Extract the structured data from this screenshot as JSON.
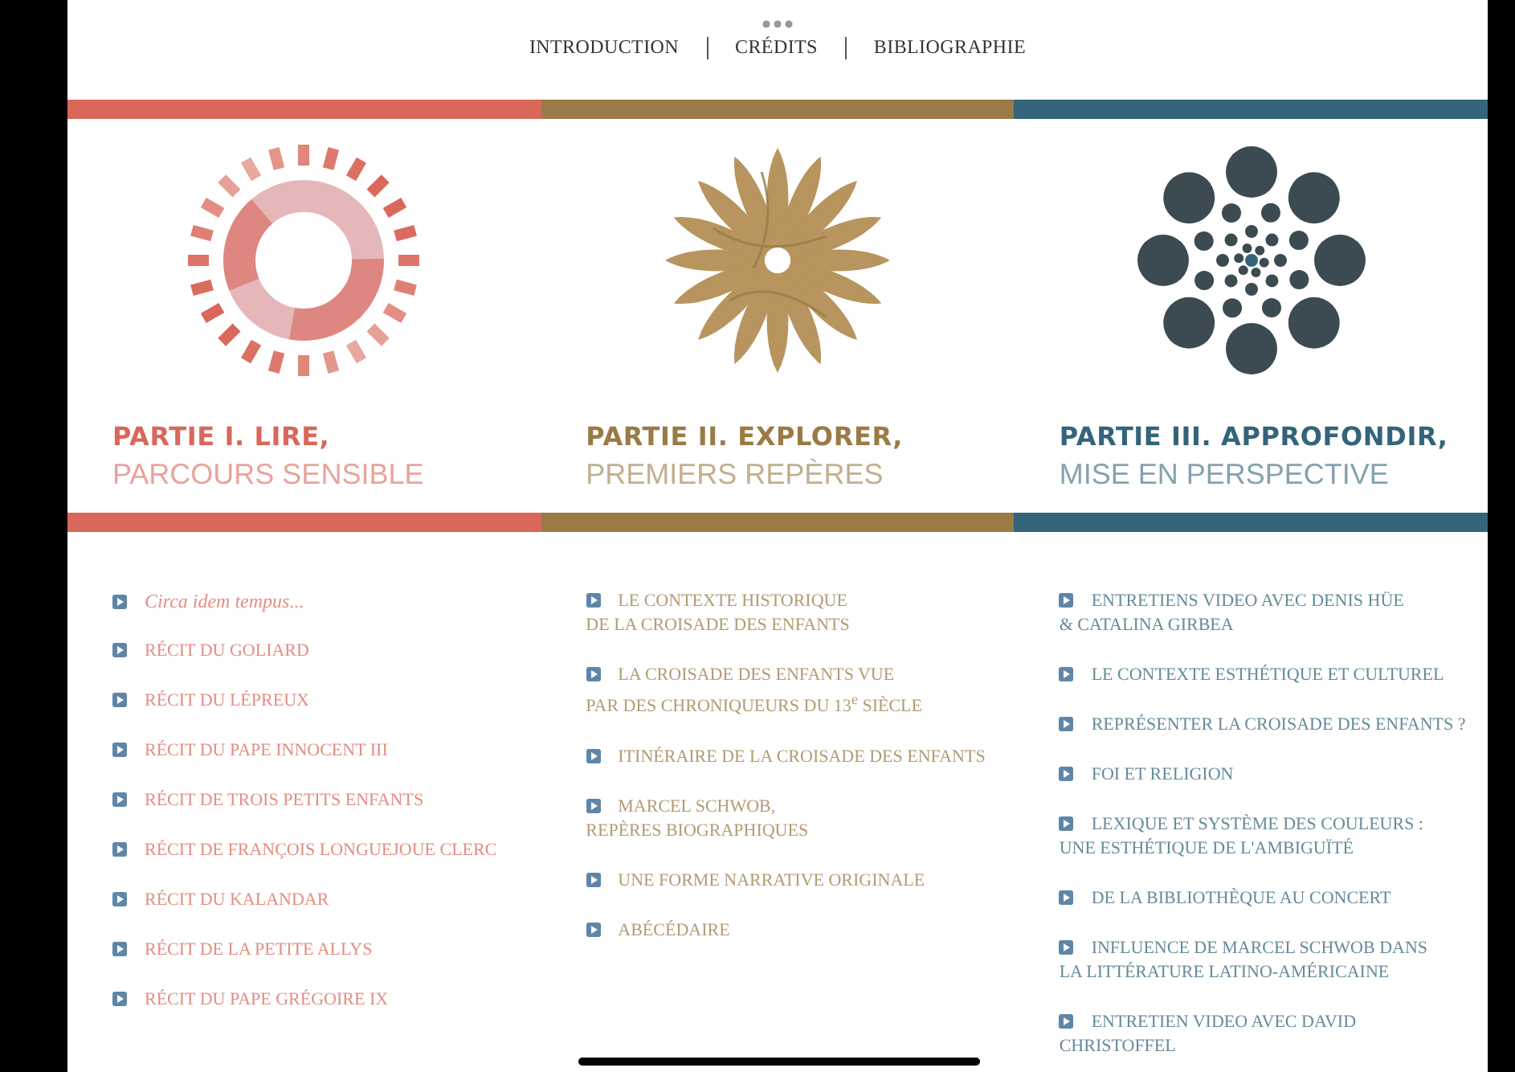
{
  "top_menu": {
    "items": [
      {
        "label": "INTRODUCTION"
      },
      {
        "label": "CRÉDITS"
      },
      {
        "label": "BIBLIOGRAPHIE"
      }
    ]
  },
  "parts": [
    {
      "color": "#d9685a",
      "kind": "ring",
      "title": "PARTIE I. LIRE,",
      "subtitle": "PARCOURS SENSIBLE",
      "links": [
        {
          "text": "Circa idem tempus...",
          "italic": true
        },
        {
          "text": "RÉCIT DU GOLIARD",
          "italic": false
        },
        {
          "text": "RÉCIT DU LÉPREUX",
          "italic": false
        },
        {
          "text": "RÉCIT DU PAPE INNOCENT III",
          "italic": false
        },
        {
          "text": "RÉCIT DE TROIS PETITS ENFANTS",
          "italic": false
        },
        {
          "text": "RÉCIT DE FRANÇOIS LONGUEJOUE CLERC",
          "italic": false
        },
        {
          "text": "RÉCIT DU KALANDAR",
          "italic": false
        },
        {
          "text": "RÉCIT DE LA PETITE ALLYS",
          "italic": false
        },
        {
          "text": "RÉCIT DU PAPE GRÉGOIRE IX",
          "italic": false
        }
      ]
    },
    {
      "color": "#9a7a45",
      "kind": "flower",
      "title": "PARTIE II. EXPLORER,",
      "subtitle": "PREMIERS REPÈRES",
      "links": [
        {
          "text": "LE CONTEXTE HISTORIQUE\nDE LA CROISADE DES ENFANTS",
          "italic": false
        },
        {
          "text": "LA CROISADE DES ENFANTS VUE\nPAR DES CHRONIQUEURS DU 13$^{e}$ SIÈCLE",
          "italic": false
        },
        {
          "text": "ITINÉRAIRE DE LA CROISADE DES ENFANTS",
          "italic": false
        },
        {
          "text": "MARCEL SCHWOB,\nREPÈRES BIOGRAPHIQUES",
          "italic": false
        },
        {
          "text": "UNE FORME NARRATIVE ORIGINALE",
          "italic": false
        },
        {
          "text": "ABÉCÉDAIRE",
          "italic": false
        }
      ]
    },
    {
      "color": "#336479",
      "kind": "circles",
      "title": "PARTIE III. APPROFONDIR,",
      "subtitle": "MISE EN PERSPECTIVE",
      "links": [
        {
          "text": "ENTRETIENS VIDEO AVEC DENIS HÜE\n& CATALINA GIRBEA",
          "italic": false
        },
        {
          "text": "LE CONTEXTE ESTHÉTIQUE ET CULTUREL",
          "italic": false
        },
        {
          "text": "REPRÉSENTER LA CROISADE DES ENFANTS ?",
          "italic": false
        },
        {
          "text": "FOI ET RELIGION",
          "italic": false
        },
        {
          "text": "LEXIQUE ET SYSTÈME DES COULEURS :\nUNE ESTHÉTIQUE DE L'AMBIGUÏTÉ",
          "italic": false
        },
        {
          "text": "DE LA BIBLIOTHÈQUE AU CONCERT",
          "italic": false
        },
        {
          "text": "INFLUENCE DE MARCEL SCHWOB DANS\nLA LITTÉRATURE LATINO-AMÉRICAINE",
          "italic": false
        },
        {
          "text": "ENTRETIEN VIDEO AVEC DAVID\nCHRISTOFFEL",
          "italic": false
        }
      ]
    }
  ]
}
